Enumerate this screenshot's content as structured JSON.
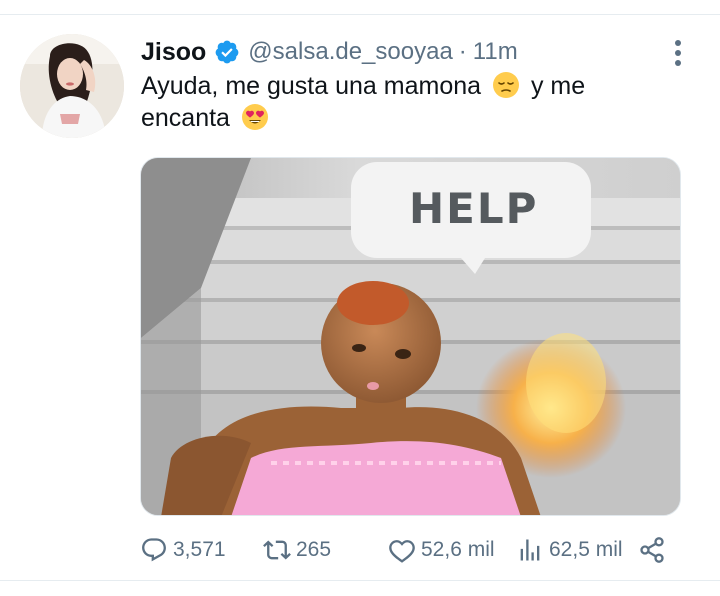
{
  "tweet": {
    "author_name": "Jisoo",
    "handle": "@salsa.de_sooyaa",
    "separator": "·",
    "time": "11m",
    "text_part1": "Ayuda, me gusta una mamona",
    "text_part2": "y me encanta",
    "emoji_1": "pensive-face",
    "emoji_2": "smiling-face-with-heart-eyes",
    "media": {
      "speech_bubble_text": "HELP"
    },
    "stats": {
      "replies": "3,571",
      "retweets": "265",
      "likes": "52,6 mil",
      "views": "62,5 mil"
    },
    "icons": {
      "verified": "verified-badge-icon",
      "more": "more-vertical-icon",
      "reply": "reply-icon",
      "retweet": "retweet-icon",
      "like": "heart-icon",
      "views": "views-icon",
      "share": "share-icon"
    },
    "colors": {
      "verified": "#1d9bf0",
      "text": "#0f1419",
      "muted": "#5b7083",
      "divider": "#e6ecf0"
    }
  }
}
